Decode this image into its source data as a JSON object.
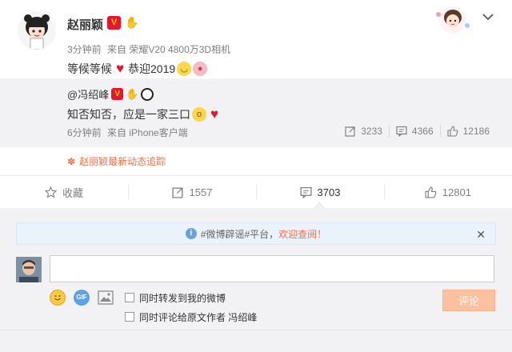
{
  "post": {
    "author": "赵丽颖",
    "verified_badge": "V",
    "meta_time": "3分钟前",
    "meta_source": "来自 荣耀V20 4800万3D相机",
    "content_text_1": "等候等候",
    "content_text_2": "恭迎2019",
    "icons": [
      "avatar-cartoon-girl",
      "verified-v-icon",
      "hand-badge-icon",
      "heart-emoji",
      "smile-emoji",
      "pig-emoji",
      "chevron-down-icon"
    ]
  },
  "repost": {
    "author": "@冯绍峰",
    "verified_badge": "V",
    "text": "知否知否，应是一家三口",
    "meta_time": "6分钟前",
    "meta_source": "来自 iPhone客户端",
    "stats": {
      "forward": "3233",
      "comment": "4366",
      "like": "12186"
    }
  },
  "follow_link": "赵丽颖最新动态追踪",
  "actions": {
    "favorite": "收藏",
    "forward": "1557",
    "comment": "3703",
    "like": "12801"
  },
  "notice": {
    "text_prefix": "#微博辟谣#平台，",
    "text_highlight": "欢迎查阅！"
  },
  "comment": {
    "input_value": "",
    "option_forward": "同时转发到我的微博",
    "option_comment_author": "同时评论给原文作者 冯绍峰",
    "submit_label": "评论",
    "gif_label": "GIF"
  },
  "colors": {
    "accent_orange": "#eb7350",
    "submit_disabled": "#ffc09f",
    "verified_red": "#e6162d",
    "panel_gray": "#f2f2f5"
  }
}
